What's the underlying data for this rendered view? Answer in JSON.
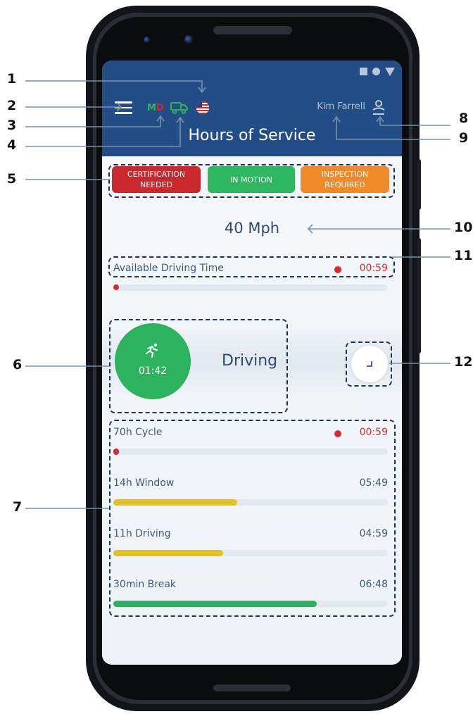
{
  "app": {
    "title": "Hours of Service",
    "menu_icon": "menu-icon",
    "region": "MD",
    "vehicle_icon": "truck-icon",
    "country_icon": "us-flag-icon",
    "user_name": "Kim Farrell",
    "user_icon": "user-icon",
    "header_color": "#234d86"
  },
  "badges": [
    {
      "label": "CERTIFICATION NEEDED",
      "color": "#c9282d"
    },
    {
      "label": "IN MOTION",
      "color": "#2fb660"
    },
    {
      "label": "INSPECTION REQUIRED",
      "color": "#ee8a2a"
    }
  ],
  "speed": "40 Mph",
  "available": {
    "label": "Available Driving Time",
    "time": "00:59",
    "progress": 0.0
  },
  "status": {
    "icon": "cyclist-icon",
    "time": "01:42",
    "label": "Driving"
  },
  "timers": [
    {
      "label": "70h Cycle",
      "time": "00:59",
      "progress": 0.0,
      "color": "#d62b30",
      "alert": true
    },
    {
      "label": "14h Window",
      "time": "05:49",
      "progress": 0.45,
      "color": "#e3c21f",
      "alert": false
    },
    {
      "label": "11h Driving",
      "time": "04:59",
      "progress": 0.4,
      "color": "#e3c21f",
      "alert": false
    },
    {
      "label": "30min Break",
      "time": "06:48",
      "progress": 0.74,
      "color": "#2db35d",
      "alert": false
    }
  ],
  "callouts": [
    "1",
    "2",
    "3",
    "4",
    "5",
    "6",
    "7",
    "8",
    "9",
    "10",
    "11",
    "12"
  ]
}
